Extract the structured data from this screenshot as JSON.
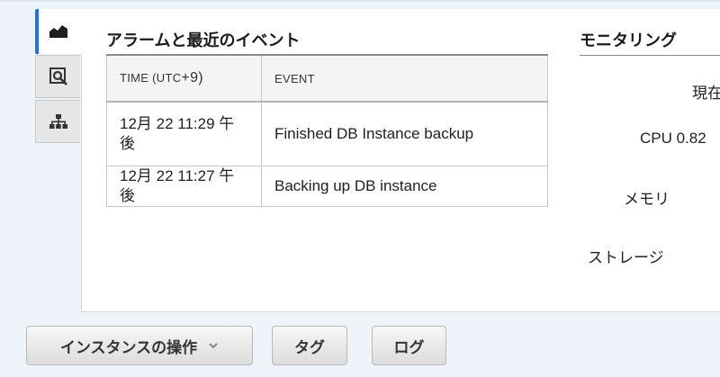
{
  "side_tabs": [
    {
      "name": "monitoring",
      "icon": "area-chart-icon",
      "active": true
    },
    {
      "name": "details",
      "icon": "magnifier-icon",
      "active": false
    },
    {
      "name": "topology",
      "icon": "hierarchy-icon",
      "active": false
    }
  ],
  "events": {
    "title": "アラームと最近のイベント",
    "columns": {
      "time_prefix": "TIME (",
      "time_utc": "UTC",
      "time_suffix": "+9)",
      "event": "EVENT"
    },
    "rows": [
      {
        "time": "12月 22 11:29 午後",
        "event": "Finished DB Instance backup"
      },
      {
        "time": "12月 22 11:27 午後",
        "event": "Backing up DB instance"
      }
    ]
  },
  "monitoring": {
    "title": "モニタリング",
    "current_label": "現在",
    "cpu_label": "CPU 0.82",
    "memory_label": "メモリ",
    "storage_label": "ストレージ"
  },
  "actions": {
    "instance_actions_label": "インスタンスの操作",
    "tags_label": "タグ",
    "logs_label": "ログ"
  },
  "colors": {
    "accent": "#2a6fd6",
    "page_bg": "#eef3fa",
    "panel_bg": "#ffffff"
  }
}
